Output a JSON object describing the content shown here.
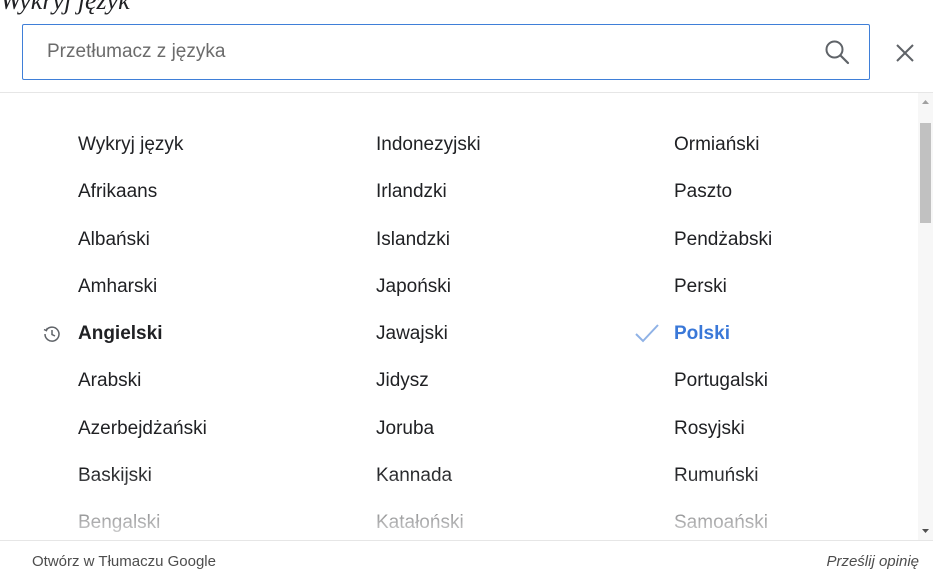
{
  "header": {
    "fragment": "Wykryj język"
  },
  "search": {
    "placeholder": "Przetłumacz z języka",
    "value": ""
  },
  "icons": {
    "search": "search-icon",
    "close": "close-icon",
    "history": "history-icon",
    "check": "check-icon"
  },
  "colors": {
    "accent": "#3a78d8",
    "border_focus": "#3f7fd8",
    "text": "#202124"
  },
  "languages": {
    "col1": [
      "Wykryj język",
      "Afrikaans",
      "Albański",
      "Amharski",
      "Angielski",
      "Arabski",
      "Azerbejdżański",
      "Baskijski",
      "Bengalski"
    ],
    "col2": [
      "Indonezyjski",
      "Irlandzki",
      "Islandzki",
      "Japoński",
      "Jawajski",
      "Jidysz",
      "Joruba",
      "Kannada",
      "Katałoński"
    ],
    "col3": [
      "Ormiański",
      "Paszto",
      "Pendżabski",
      "Perski",
      "Polski",
      "Portugalski",
      "Rosyjski",
      "Rumuński",
      "Samoański"
    ]
  },
  "recent_language": "Angielski",
  "selected_language": "Polski",
  "footer": {
    "open_link": "Otwórz w Tłumaczu Google",
    "feedback_link": "Prześlij opinię"
  }
}
